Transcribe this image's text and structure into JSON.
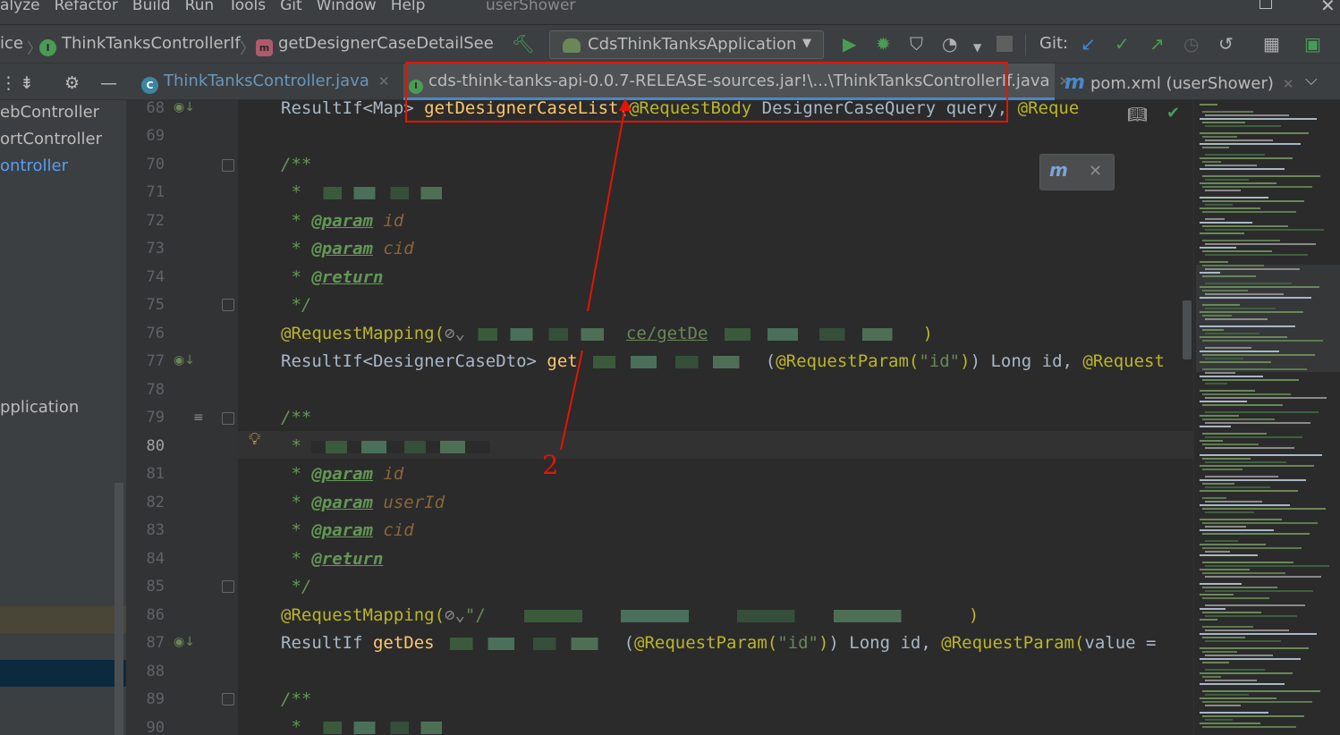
{
  "menubar": {
    "items": [
      "alyze",
      "Refactor",
      "Build",
      "Run",
      "Tools",
      "Git",
      "Window",
      "Help"
    ],
    "title": "userShower"
  },
  "navbar": {
    "crumbs": [
      "ice",
      "ThinkTanksControllerIf",
      "getDesignerCaseDetailSee"
    ],
    "run_config": "CdsThinkTanksApplication",
    "git_label": "Git:"
  },
  "tabs": [
    {
      "label": "ThinkTanksController.java",
      "icon": "class-icon"
    },
    {
      "label": "cds-think-tanks-api-0.0.7-RELEASE-sources.jar!\\...\\ThinkTanksControllerIf.java",
      "icon": "interface-icon",
      "active": true
    },
    {
      "label": "pom.xml (userShower)",
      "icon": "maven-icon"
    }
  ],
  "sidebar": {
    "items": [
      "ebController",
      "ortController",
      "ontroller",
      "pplication"
    ]
  },
  "gutter": {
    "line_numbers": [
      "68",
      "69",
      "70",
      "71",
      "72",
      "73",
      "74",
      "75",
      "76",
      "77",
      "78",
      "79",
      "80",
      "81",
      "82",
      "83",
      "84",
      "85",
      "86",
      "87",
      "88",
      "89",
      "90"
    ]
  },
  "code": {
    "l68": {
      "a": "ResultIf<Map> ",
      "b": "getDesignerCaseList",
      "c": "(",
      "d": "@RequestBody",
      "e": " DesignerCaseQuery query, ",
      "f": "@Reque"
    },
    "l70": "/**",
    "l71": " * ",
    "l72": {
      "p": " * ",
      "t": "@param",
      "v": " id"
    },
    "l73": {
      "p": " * ",
      "t": "@param",
      "v": " cid"
    },
    "l74": {
      "p": " * ",
      "t": "@return"
    },
    "l75": " */",
    "l76": {
      "a": "@RequestMapping(",
      "s": "ce/getDe",
      "e": ")"
    },
    "l77": {
      "a": "ResultIf<DesignerCaseDto> ",
      "b": "get",
      "c": "(",
      "d": "@RequestParam(",
      "s": "\"id\"",
      "e": ") Long id, ",
      "f": "@Request"
    },
    "l79": "/**",
    "l80": " * ",
    "l81": {
      "p": " * ",
      "t": "@param",
      "v": " id"
    },
    "l82": {
      "p": " * ",
      "t": "@param",
      "v": " userId"
    },
    "l83": {
      "p": " * ",
      "t": "@param",
      "v": " cid"
    },
    "l84": {
      "p": " * ",
      "t": "@return"
    },
    "l85": " */",
    "l86": {
      "a": "@RequestMapping(",
      "s": "\"/",
      "e": ")"
    },
    "l87": {
      "a": "ResultIf ",
      "b": "getDes",
      "c": "(",
      "d": "@RequestParam(",
      "s": "\"id\"",
      "e": ") Long id, ",
      "f": "@RequestParam(",
      "g": "value ="
    },
    "l89": "/**",
    "l90": " * "
  },
  "annotation": {
    "number": "2",
    "color": "#e51400"
  },
  "colors": {
    "accent": "#4a88c7",
    "annotation": "#e51400",
    "keyword": "#cc7832",
    "annotation_code": "#bbb529",
    "comment": "#629755"
  }
}
